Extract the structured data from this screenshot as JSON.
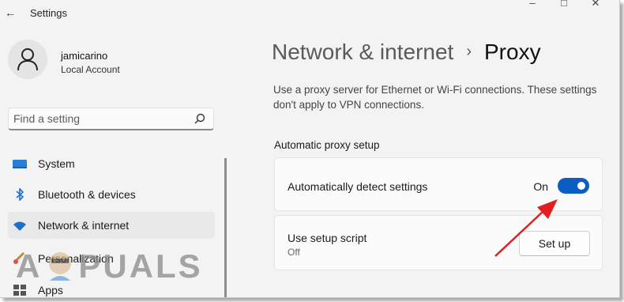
{
  "window": {
    "title": "Settings"
  },
  "title_controls": {
    "minimize": "–",
    "maximize": "□",
    "close": "✕"
  },
  "user": {
    "name": "jamicarino",
    "account_type": "Local Account"
  },
  "search": {
    "placeholder": "Find a setting"
  },
  "sidebar": {
    "items": [
      {
        "label": "System",
        "icon": "monitor-icon",
        "active": false
      },
      {
        "label": "Bluetooth & devices",
        "icon": "bluetooth-icon",
        "active": false
      },
      {
        "label": "Network & internet",
        "icon": "wifi-icon",
        "active": true
      },
      {
        "label": "Personalization",
        "icon": "brush-icon",
        "active": false
      },
      {
        "label": "Apps",
        "icon": "apps-icon",
        "active": false
      }
    ]
  },
  "breadcrumb": {
    "parent": "Network & internet",
    "separator": "›",
    "current": "Proxy"
  },
  "description": "Use a proxy server for Ethernet or Wi-Fi connections. These settings don't apply to VPN connections.",
  "section": {
    "title": "Automatic proxy setup"
  },
  "auto_detect": {
    "label": "Automatically detect settings",
    "state_text": "On",
    "enabled": true
  },
  "setup_script": {
    "label": "Use setup script",
    "state_text": "Off",
    "button_label": "Set up"
  },
  "watermark": {
    "text_a": "A",
    "text_rest": "PUALS"
  },
  "colors": {
    "accent": "#0a5ec2",
    "arrow": "#e02020",
    "background": "#f3f3f3",
    "card": "#fbfbfb"
  }
}
